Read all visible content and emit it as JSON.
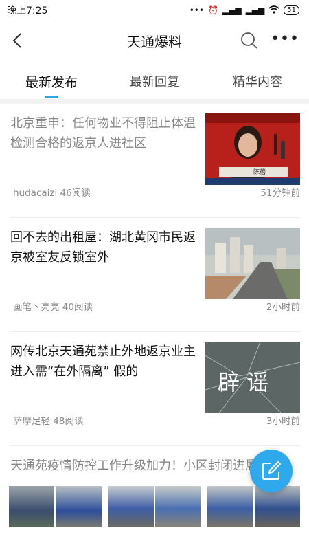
{
  "status": {
    "time": "晚上7:25",
    "battery": "51"
  },
  "header": {
    "title": "天通爆料"
  },
  "tabs": [
    {
      "label": "最新发布"
    },
    {
      "label": "最新回复"
    },
    {
      "label": "精华内容"
    }
  ],
  "posts": [
    {
      "title": "北京重申：任何物业不得阻止体温检测合格的返京人进社区",
      "meta": "hudacaizi 46阅读",
      "time": "51分钟前",
      "thumb_caption": "陈蓓"
    },
    {
      "title": "回不去的出租屋：湖北黄冈市民返京被室友反锁室外",
      "meta": "画笔丶亮亮 40阅读",
      "time": "2小时前"
    },
    {
      "title": "网传北京天通苑禁止外地返京业主进入需“在外隔离” 假的",
      "meta": "萨摩足轻 48阅读",
      "time": "3小时前",
      "thumb_caption": "辟 谣"
    },
    {
      "title": "天通苑疫情防控工作升级加力！小区封闭进展"
    }
  ],
  "colors": {
    "accent": "#2aa6e8",
    "fab": "#2ea9ec"
  }
}
